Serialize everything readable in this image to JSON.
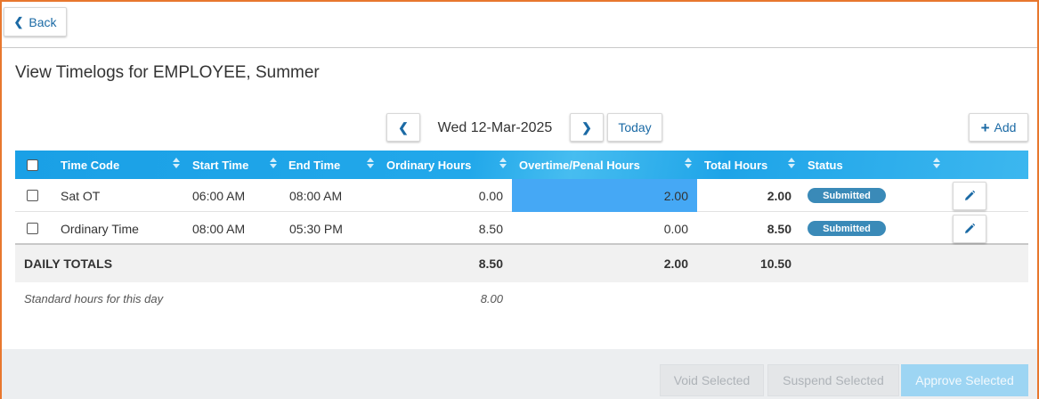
{
  "header": {
    "back_label": "Back",
    "title": "View Timelogs for EMPLOYEE, Summer"
  },
  "date_nav": {
    "date": "Wed 12-Mar-2025",
    "today_label": "Today",
    "add_label": "Add"
  },
  "table": {
    "columns": [
      "Time Code",
      "Start Time",
      "End Time",
      "Ordinary Hours",
      "Overtime/Penal Hours",
      "Total Hours",
      "Status"
    ],
    "rows": [
      {
        "checked": false,
        "time_code": "Sat OT",
        "start": "06:00 AM",
        "end": "08:00 AM",
        "ordinary": "0.00",
        "overtime": "2.00",
        "total": "2.00",
        "status": "Submitted"
      },
      {
        "checked": false,
        "time_code": "Ordinary Time",
        "start": "08:00 AM",
        "end": "05:30 PM",
        "ordinary": "8.50",
        "overtime": "0.00",
        "total": "8.50",
        "status": "Submitted"
      }
    ],
    "totals": {
      "label": "DAILY TOTALS",
      "ordinary": "8.50",
      "overtime": "2.00",
      "total": "10.50"
    },
    "standard": {
      "label": "Standard hours for this day",
      "value": "8.00"
    }
  },
  "footer": {
    "void_label": "Void Selected",
    "suspend_label": "Suspend Selected",
    "approve_label": "Approve Selected"
  },
  "colors": {
    "accent": "#1b6aa5",
    "header_blue": "#1aa0e6",
    "highlight": "#45a8f5",
    "badge": "#3a8ab8",
    "frame": "#e8772e"
  }
}
